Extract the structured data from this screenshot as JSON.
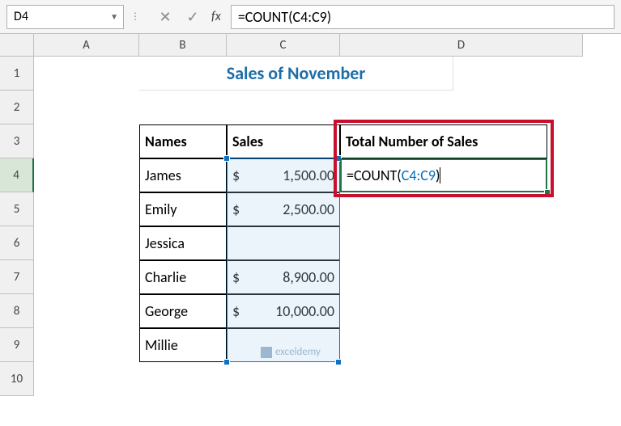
{
  "formula_bar": {
    "name_box": "D4",
    "formula": "=COUNT(C4:C9)"
  },
  "columns": [
    "A",
    "B",
    "C",
    "D"
  ],
  "rows": [
    "1",
    "2",
    "3",
    "4",
    "5",
    "6",
    "7",
    "8",
    "9",
    "10"
  ],
  "title": "Sales of November",
  "headers": {
    "names": "Names",
    "sales": "Sales",
    "total": "Total Number of Sales"
  },
  "data_rows": [
    {
      "name": "James",
      "sales": "1,500.00"
    },
    {
      "name": "Emily",
      "sales": "2,500.00"
    },
    {
      "name": "Jessica",
      "sales": ""
    },
    {
      "name": "Charlie",
      "sales": "8,900.00"
    },
    {
      "name": "George",
      "sales": "10,000.00"
    },
    {
      "name": "Millie",
      "sales": ""
    }
  ],
  "active_cell": {
    "prefix": "=COUNT(",
    "range": "C4:C9",
    "suffix": ")"
  },
  "currency": "$",
  "watermark": "exceldemy"
}
